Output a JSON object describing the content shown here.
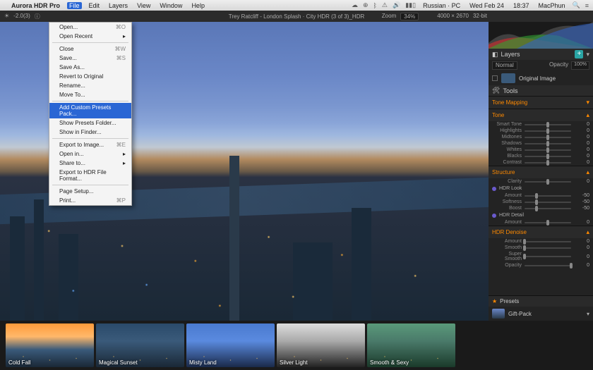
{
  "menubar": {
    "app_name": "Aurora HDR Pro",
    "items": [
      "File",
      "Edit",
      "Layers",
      "View",
      "Window",
      "Help"
    ],
    "status_lang": "Russian · PC",
    "status_date": "Wed Feb 24",
    "status_time": "18:37",
    "status_user": "MacPhun"
  },
  "toolbar": {
    "doc_title": "Trey Ratcliff - London Splash · City HDR (3 of 3)_HDR",
    "zoom_label": "Zoom",
    "zoom_value": "34%",
    "dimensions": "4000 × 2670",
    "bit_depth": "32-bit"
  },
  "file_menu": [
    {
      "label": "Open...",
      "shortcut": "⌘O"
    },
    {
      "label": "Open Recent",
      "shortcut": "▸"
    },
    "-",
    {
      "label": "Close",
      "shortcut": "⌘W"
    },
    {
      "label": "Save...",
      "shortcut": "⌘S"
    },
    {
      "label": "Save As..."
    },
    {
      "label": "Revert to Original"
    },
    {
      "label": "Rename..."
    },
    {
      "label": "Move To..."
    },
    "-",
    {
      "label": "Add Custom Presets Pack...",
      "hi": true
    },
    {
      "label": "Show Presets Folder..."
    },
    {
      "label": "Show in Finder..."
    },
    "-",
    {
      "label": "Export to Image...",
      "shortcut": "⌘E"
    },
    {
      "label": "Open in...",
      "shortcut": "▸"
    },
    {
      "label": "Share to...",
      "shortcut": "▸"
    },
    {
      "label": "Export to HDR File Format..."
    },
    "-",
    {
      "label": "Page Setup..."
    },
    {
      "label": "Print...",
      "shortcut": "⌘P"
    }
  ],
  "layers": {
    "title": "Layers",
    "blend_label": "Normal",
    "opacity_label": "Opacity",
    "opacity_value": "100%",
    "row_name": "Original Image"
  },
  "tools": {
    "title": "Tools",
    "tone_mapping": {
      "label": "Tone Mapping"
    },
    "tone": {
      "label": "Tone",
      "sliders": [
        {
          "name": "Smart Tone",
          "value": 0,
          "pos": 50
        },
        {
          "name": "Highlights",
          "value": 0,
          "pos": 50
        },
        {
          "name": "Midtones",
          "value": 0,
          "pos": 50
        },
        {
          "name": "Shadows",
          "value": 0,
          "pos": 50
        },
        {
          "name": "Whites",
          "value": 0,
          "pos": 50
        },
        {
          "name": "Blacks",
          "value": 0,
          "pos": 50
        },
        {
          "name": "Contrast",
          "value": 0,
          "pos": 50
        }
      ]
    },
    "structure": {
      "label": "Structure",
      "clarity": {
        "name": "Clarity",
        "value": 0,
        "pos": 50
      },
      "hdr_look": {
        "label": "HDR Look",
        "sliders": [
          {
            "name": "Amount",
            "value": -50,
            "pos": 25
          },
          {
            "name": "Softness",
            "value": -50,
            "pos": 25
          },
          {
            "name": "Boost",
            "value": -50,
            "pos": 25
          }
        ]
      },
      "hdr_detail": {
        "label": "HDR Detail",
        "sliders": [
          {
            "name": "Amount",
            "value": 0,
            "pos": 50
          }
        ]
      }
    },
    "hdr_denoise": {
      "label": "HDR Denoise",
      "sliders": [
        {
          "name": "Amount",
          "value": 0,
          "pos": 0
        },
        {
          "name": "Smooth",
          "value": 0,
          "pos": 0
        },
        {
          "name": "Super Smooth",
          "value": 0,
          "pos": 0
        },
        {
          "name": "Opacity",
          "value": 0,
          "pos": 100
        }
      ]
    }
  },
  "presets": {
    "label": "Presets",
    "pack": "Gift-Pack",
    "thumbs": [
      {
        "name": "Cold Fall",
        "tone": "sun"
      },
      {
        "name": "Magical Sunset",
        "tone": "night"
      },
      {
        "name": "Misty Land",
        "tone": "blue"
      },
      {
        "name": "Silver Light",
        "tone": "bw"
      },
      {
        "name": "Smooth & Sexy",
        "tone": "green"
      }
    ]
  }
}
